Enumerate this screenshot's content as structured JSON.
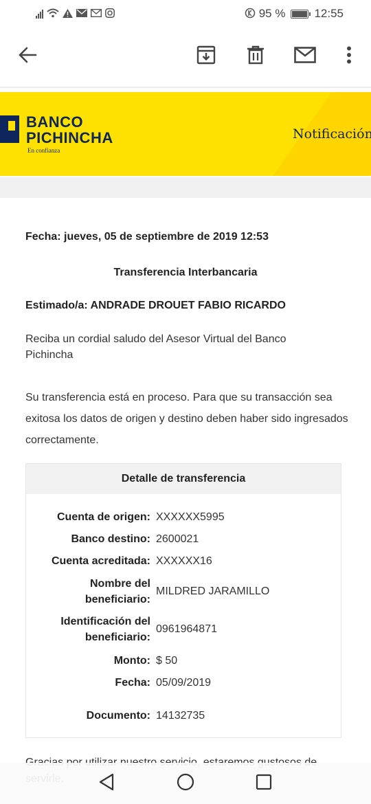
{
  "status_bar": {
    "battery_text": "95 %",
    "time": "12:55"
  },
  "toolbar": {
    "back_icon": "arrow-left-icon",
    "archive_icon": "archive-icon",
    "delete_icon": "trash-icon",
    "mail_icon": "mail-icon",
    "more_icon": "more-vertical-icon"
  },
  "banner": {
    "brand_line1": "BANCO",
    "brand_line2": "PICHINCHA",
    "tagline": "En confianza",
    "notification_label": "Notificación",
    "colors": {
      "yellow": "#ffe100",
      "navy": "#0f265c"
    }
  },
  "email": {
    "fecha": "Fecha: jueves, 05 de septiembre de 2019 12:53",
    "subject": "Transferencia Interbancaria",
    "greeting": "Estimado/a: ANDRADE DROUET FABIO RICARDO",
    "intro": "Reciba un cordial saludo del Asesor Virtual del Banco Pichincha",
    "body": "Su transferencia está en proceso. Para que su transacción sea exitosa los datos de origen y destino deben haber sido ingresados correctamente.",
    "detail": {
      "title": "Detalle de transferencia",
      "rows": [
        {
          "label": "Cuenta de origen:",
          "value": "XXXXXX5995"
        },
        {
          "label": "Banco destino:",
          "value": "2600021"
        },
        {
          "label": "Cuenta acreditada:",
          "value": "XXXXXX16"
        },
        {
          "label": "Nombre del beneficiario:",
          "value": "MILDRED JARAMILLO"
        },
        {
          "label": "Identificación del beneficiario:",
          "value": "0961964871"
        },
        {
          "label": "Monto:",
          "value": "$ 50"
        },
        {
          "label": "Fecha:",
          "value": "05/09/2019"
        },
        {
          "label": "Documento:",
          "value": "14132735"
        }
      ]
    },
    "closing": "Gracias por utilizar nuestro servicio, estaremos gustosos de servirle."
  }
}
